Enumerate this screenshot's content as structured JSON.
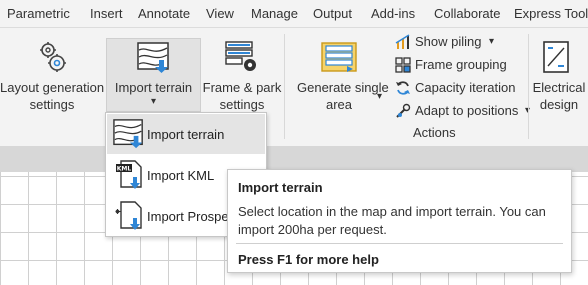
{
  "tabs": [
    "Parametric",
    "Insert",
    "Annotate",
    "View",
    "Manage",
    "Output",
    "Add-ins",
    "Collaborate",
    "Express Tools"
  ],
  "ribbon": {
    "layout_generation": {
      "line1": "Layout generation",
      "line2": "settings"
    },
    "import_terrain": {
      "label": "Import terrain",
      "arrow": "▾"
    },
    "frame_park": {
      "line1": "Frame & park",
      "line2": "settings"
    },
    "generate_single": {
      "line1": "Generate single",
      "line2": "area",
      "arrow": "▾"
    },
    "show_piling": {
      "label": "Show piling",
      "arrow": "▾"
    },
    "frame_grouping": {
      "label": "Frame grouping"
    },
    "capacity_iteration": {
      "label": "Capacity iteration"
    },
    "adapt_positions": {
      "label": "Adapt to positions",
      "arrow": "▾"
    },
    "actions_group": "Actions",
    "electrical": {
      "line1": "Electrical",
      "line2": "design"
    }
  },
  "dropdown": {
    "items": [
      {
        "label": "Import terrain",
        "icon": "terrain-icon"
      },
      {
        "label": "Import KML",
        "icon": "kml-file-icon"
      },
      {
        "label": "Import Prospec",
        "icon": "prospect-file-icon"
      }
    ]
  },
  "tooltip": {
    "title": "Import terrain",
    "body": "Select location in the map and import terrain. You can import 200ha per request.",
    "help": "Press F1 for more help"
  },
  "colors": {
    "accent_blue": "#2f86d6",
    "selection_bg": "#e4e4e4"
  }
}
